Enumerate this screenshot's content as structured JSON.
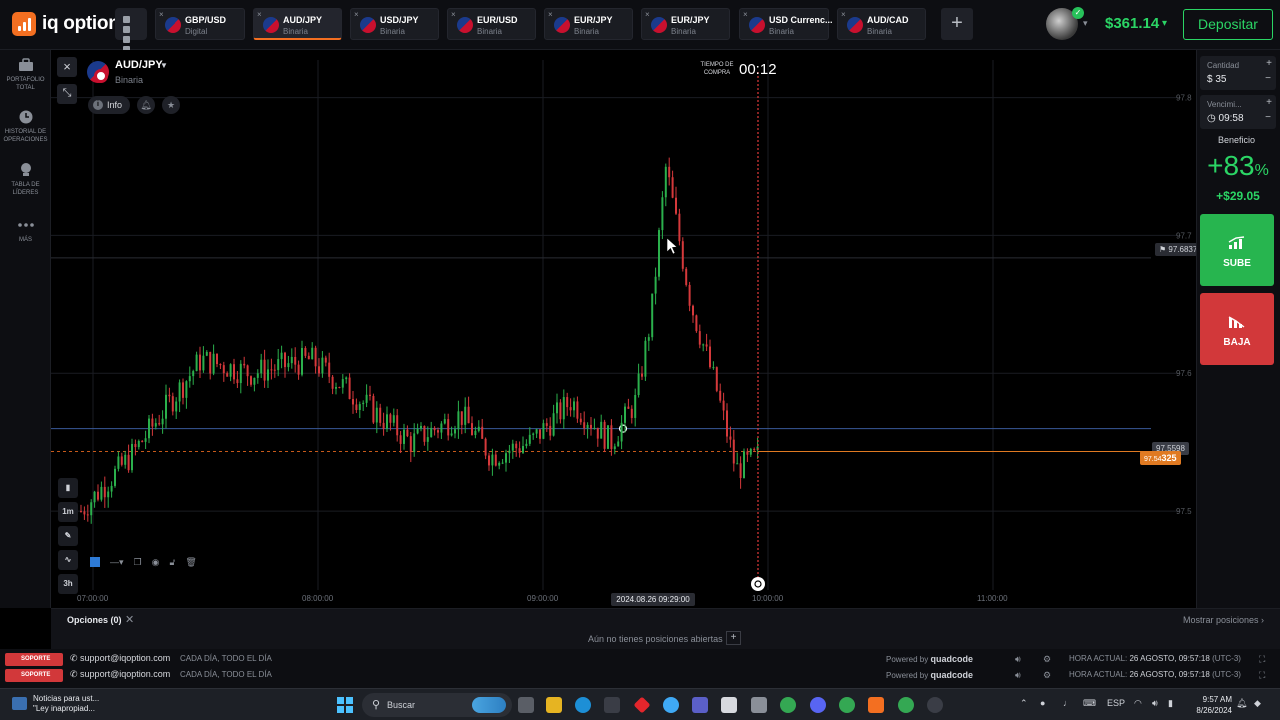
{
  "brand": {
    "name": "iq option",
    "color": "#f36f21"
  },
  "tabs": [
    {
      "symbol": "GBP/USD",
      "type": "Digital",
      "active": false
    },
    {
      "symbol": "AUD/JPY",
      "type": "Binaria",
      "active": true
    },
    {
      "symbol": "USD/JPY",
      "type": "Binaria",
      "active": false
    },
    {
      "symbol": "EUR/USD",
      "type": "Binaria",
      "active": false
    },
    {
      "symbol": "EUR/JPY",
      "type": "Binaria",
      "active": false
    },
    {
      "symbol": "EUR/JPY",
      "type": "Binaria",
      "active": false
    },
    {
      "symbol": "USD Currenc...",
      "type": "Binaria",
      "active": false
    },
    {
      "symbol": "AUD/CAD",
      "type": "Binaria",
      "active": false
    }
  ],
  "account": {
    "balance": "$361.14",
    "deposit_label": "Depositar"
  },
  "leftnav": [
    {
      "label": "Portafolio total",
      "icon": "briefcase-icon"
    },
    {
      "label": "Historial de operaciones",
      "icon": "clock-icon"
    },
    {
      "label": "Tabla de líderes",
      "icon": "trophy-icon"
    },
    {
      "label": "Más",
      "icon": "more-dots-icon"
    }
  ],
  "chart_header": {
    "asset": "AUD/JPY",
    "type": "Binaria",
    "info_label": "Info",
    "purchase_time_label": "Tiempo de compra",
    "purchase_time": "00:12"
  },
  "chart_tools": {
    "timeframe": "1m",
    "range": "3h"
  },
  "price_axis": {
    "ticks": [
      "97.8",
      "97.7",
      "97.6",
      "97.5"
    ],
    "alert_price": "97.6837",
    "line_price": "97.5598",
    "current_price_prefix": "97.54",
    "current_price_suffix": "325"
  },
  "time_axis": {
    "ticks": [
      "07:00:00",
      "08:00:00",
      "09:00:00",
      "10:00:00",
      "11:00:00"
    ],
    "cursor": "2024.08.26 09:29:00"
  },
  "chart_data": {
    "type": "candlestick",
    "ylim": [
      97.45,
      97.82
    ],
    "y_ticks": [
      97.5,
      97.6,
      97.7,
      97.8
    ],
    "x_ticks": [
      "07:00:00",
      "08:00:00",
      "09:00:00",
      "10:00:00",
      "11:00:00"
    ],
    "current_price": 97.54325,
    "horizontal_line": 97.5598,
    "alert_line": 97.6837,
    "expiry_time": "10:00:00"
  },
  "right_panel": {
    "amount_label": "Cantidad",
    "amount_currency": "$",
    "amount": "35",
    "expiry_label": "Vencimi...",
    "expiry": "09:58",
    "profit_label": "Beneficio",
    "profit_pct": "+83",
    "profit_pct_sign": "%",
    "profit_amount": "+$29.05",
    "up_label": "SUBE",
    "down_label": "BAJA",
    "up_color": "#27b54f",
    "down_color": "#d2383a"
  },
  "positions": {
    "tab_label": "Opciones (0)",
    "empty_text": "Aún no tienes posiciones abiertas",
    "show_label": "Mostrar posiciones"
  },
  "footer": {
    "support_label": "SOPORTE",
    "email": "support@iqoption.com",
    "schedule": "CADA DÍA, TODO EL DÍA",
    "powered_by": "Powered by",
    "powered_brand": "quadcode",
    "time_label": "HORA ACTUAL:",
    "time_value": "26 AGOSTO, 09:57:18",
    "tz": "(UTC-3)"
  },
  "taskbar": {
    "news_line1": "Noticias para ust...",
    "news_line2": "\"Ley inapropiad...",
    "search_label": "Buscar",
    "lang": "ESP",
    "clock_time": "9:57 AM",
    "clock_date": "8/26/2024"
  }
}
